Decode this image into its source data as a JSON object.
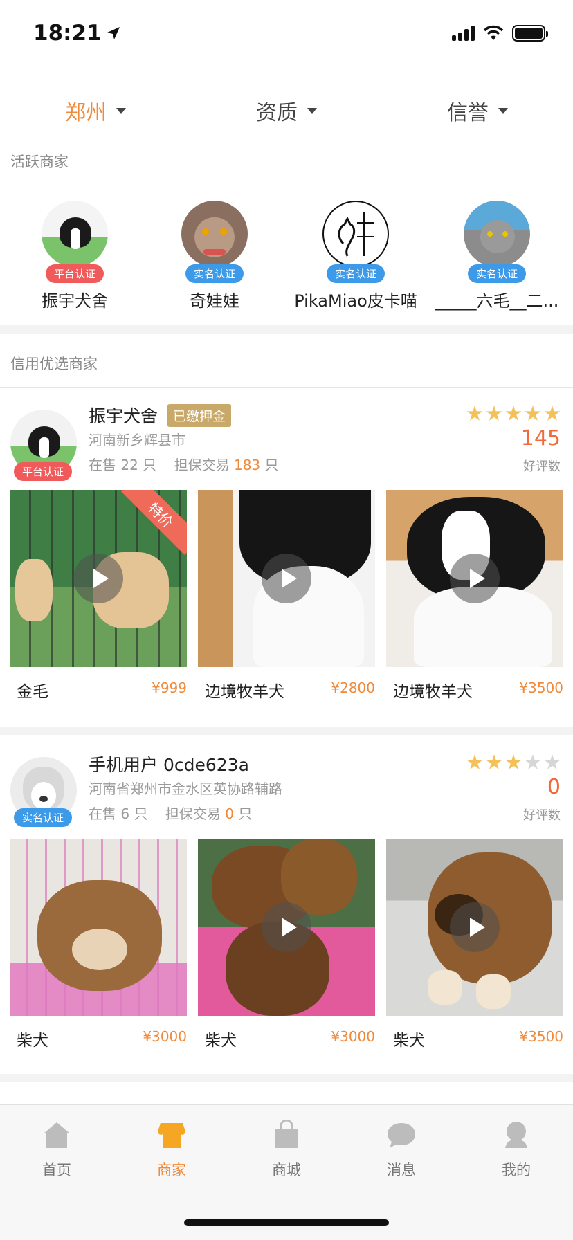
{
  "status": {
    "time": "18:21"
  },
  "filters": [
    {
      "label": "郑州",
      "active": true
    },
    {
      "label": "资质",
      "active": false
    },
    {
      "label": "信誉",
      "active": false
    }
  ],
  "active_section": {
    "title": "活跃商家",
    "merchants": [
      {
        "name": "振宇犬舍",
        "badge": "平台认证"
      },
      {
        "name": "奇娃娃",
        "badge": "实名认证"
      },
      {
        "name": "PikaMiao皮卡喵",
        "badge": "实名认证"
      },
      {
        "name": "_____六毛__二...",
        "badge": "实名认证"
      }
    ]
  },
  "credit_section": {
    "title": "信用优选商家"
  },
  "cards": [
    {
      "name": "振宇犬舍",
      "deposit": "已缴押金",
      "badge": "平台认证",
      "address": "河南新乡辉县市",
      "on_sale_prefix": "在售",
      "on_sale": "22",
      "unit": "只",
      "guarantee_prefix": "担保交易",
      "guarantee": "183",
      "rating": 5,
      "score": "145",
      "score_label": "好评数",
      "products": [
        {
          "name": "金毛",
          "price": "¥999",
          "tag": "特价"
        },
        {
          "name": "边境牧羊犬",
          "price": "¥2800"
        },
        {
          "name": "边境牧羊犬",
          "price": "¥3500"
        }
      ]
    },
    {
      "name": "手机用户 0cde623a",
      "badge": "实名认证",
      "address": "河南省郑州市金水区英协路辅路",
      "on_sale_prefix": "在售",
      "on_sale": "6",
      "unit": "只",
      "guarantee_prefix": "担保交易",
      "guarantee": "0",
      "rating": 3,
      "score": "0",
      "score_label": "好评数",
      "products": [
        {
          "name": "柴犬",
          "price": "¥3000"
        },
        {
          "name": "柴犬",
          "price": "¥3000"
        },
        {
          "name": "柴犬",
          "price": "¥3500"
        }
      ]
    }
  ],
  "tabbar": [
    {
      "label": "首页",
      "icon": "home-icon",
      "active": false
    },
    {
      "label": "商家",
      "icon": "shop-icon",
      "active": true
    },
    {
      "label": "商城",
      "icon": "bag-icon",
      "active": false
    },
    {
      "label": "消息",
      "icon": "chat-icon",
      "active": false
    },
    {
      "label": "我的",
      "icon": "profile-icon",
      "active": false
    }
  ],
  "colors": {
    "accent": "#f08a3b",
    "platform_badge": "#f05a5a",
    "realname_badge": "#3d9ae8",
    "deposit": "#c9a96a"
  }
}
